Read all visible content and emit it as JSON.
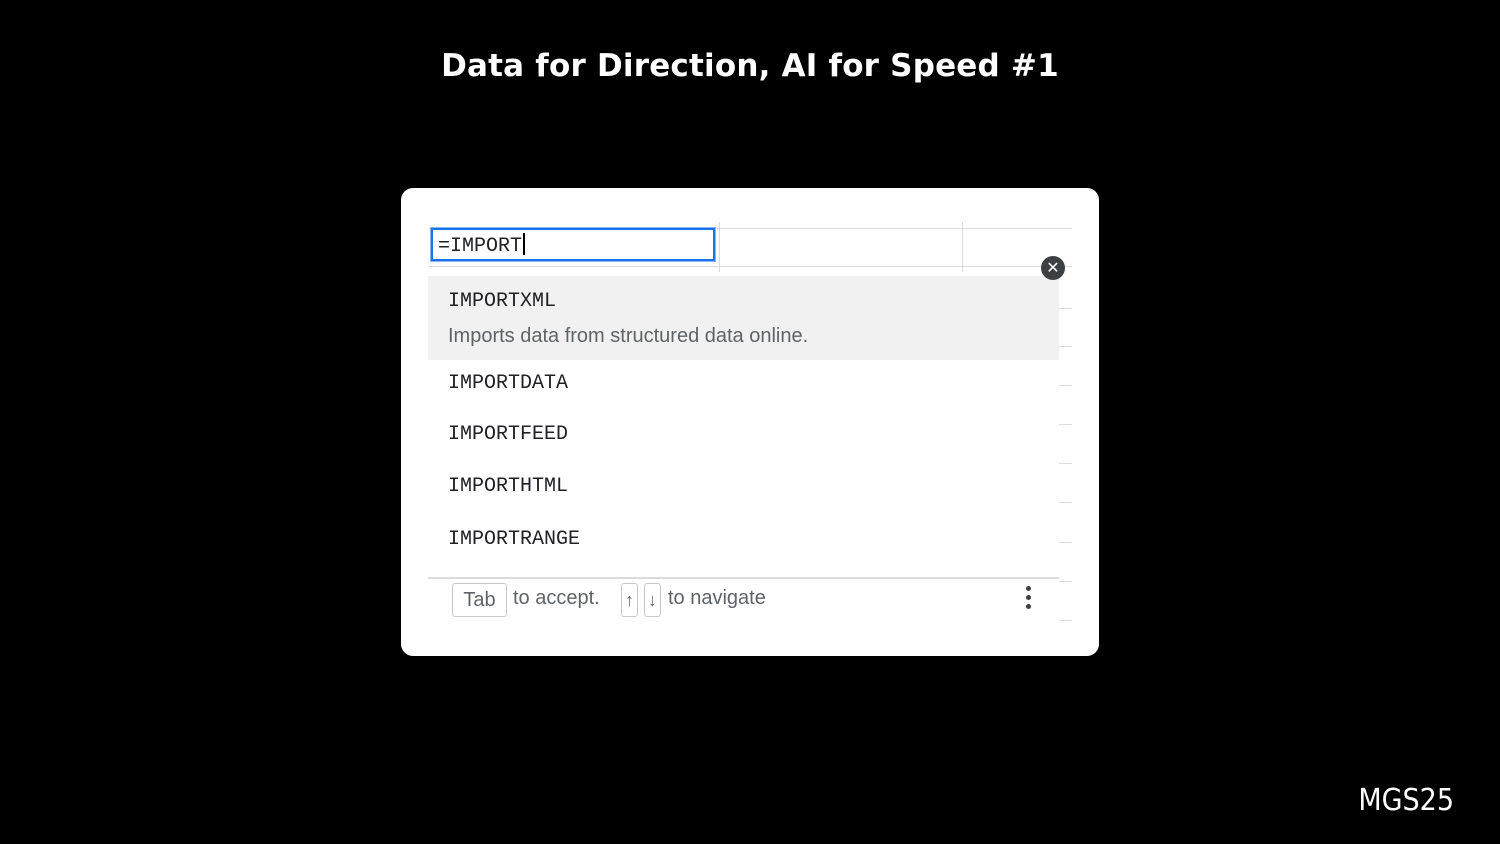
{
  "slide": {
    "title": "Data for Direction, AI for Speed #1",
    "watermark": "MGS25"
  },
  "cell_editor": {
    "value": "=IMPORT"
  },
  "autocomplete": {
    "items": [
      {
        "name": "IMPORTXML",
        "description": "Imports data from structured data online.",
        "active": true
      },
      {
        "name": "IMPORTDATA"
      },
      {
        "name": "IMPORTFEED"
      },
      {
        "name": "IMPORTHTML"
      },
      {
        "name": "IMPORTRANGE"
      }
    ],
    "footer": {
      "tab_key": "Tab",
      "accept_text": "to accept.",
      "up_key": "↑",
      "down_key": "↓",
      "navigate_text": "to navigate"
    }
  },
  "icons": {
    "close": "close-icon",
    "more": "more-vert-icon"
  }
}
